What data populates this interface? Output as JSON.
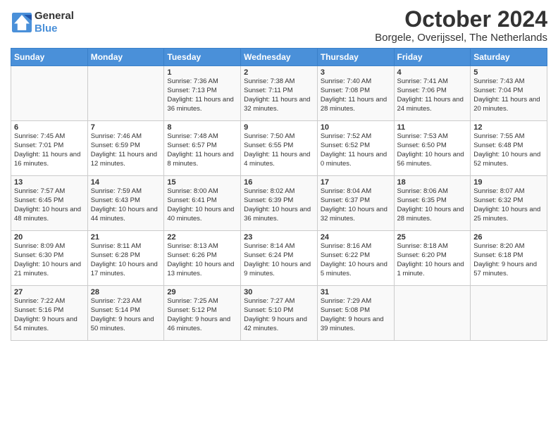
{
  "header": {
    "logo_line1": "General",
    "logo_line2": "Blue",
    "title": "October 2024",
    "subtitle": "Borgele, Overijssel, The Netherlands"
  },
  "days_of_week": [
    "Sunday",
    "Monday",
    "Tuesday",
    "Wednesday",
    "Thursday",
    "Friday",
    "Saturday"
  ],
  "weeks": [
    [
      {
        "day": "",
        "info": ""
      },
      {
        "day": "",
        "info": ""
      },
      {
        "day": "1",
        "info": "Sunrise: 7:36 AM\nSunset: 7:13 PM\nDaylight: 11 hours and 36 minutes."
      },
      {
        "day": "2",
        "info": "Sunrise: 7:38 AM\nSunset: 7:11 PM\nDaylight: 11 hours and 32 minutes."
      },
      {
        "day": "3",
        "info": "Sunrise: 7:40 AM\nSunset: 7:08 PM\nDaylight: 11 hours and 28 minutes."
      },
      {
        "day": "4",
        "info": "Sunrise: 7:41 AM\nSunset: 7:06 PM\nDaylight: 11 hours and 24 minutes."
      },
      {
        "day": "5",
        "info": "Sunrise: 7:43 AM\nSunset: 7:04 PM\nDaylight: 11 hours and 20 minutes."
      }
    ],
    [
      {
        "day": "6",
        "info": "Sunrise: 7:45 AM\nSunset: 7:01 PM\nDaylight: 11 hours and 16 minutes."
      },
      {
        "day": "7",
        "info": "Sunrise: 7:46 AM\nSunset: 6:59 PM\nDaylight: 11 hours and 12 minutes."
      },
      {
        "day": "8",
        "info": "Sunrise: 7:48 AM\nSunset: 6:57 PM\nDaylight: 11 hours and 8 minutes."
      },
      {
        "day": "9",
        "info": "Sunrise: 7:50 AM\nSunset: 6:55 PM\nDaylight: 11 hours and 4 minutes."
      },
      {
        "day": "10",
        "info": "Sunrise: 7:52 AM\nSunset: 6:52 PM\nDaylight: 11 hours and 0 minutes."
      },
      {
        "day": "11",
        "info": "Sunrise: 7:53 AM\nSunset: 6:50 PM\nDaylight: 10 hours and 56 minutes."
      },
      {
        "day": "12",
        "info": "Sunrise: 7:55 AM\nSunset: 6:48 PM\nDaylight: 10 hours and 52 minutes."
      }
    ],
    [
      {
        "day": "13",
        "info": "Sunrise: 7:57 AM\nSunset: 6:45 PM\nDaylight: 10 hours and 48 minutes."
      },
      {
        "day": "14",
        "info": "Sunrise: 7:59 AM\nSunset: 6:43 PM\nDaylight: 10 hours and 44 minutes."
      },
      {
        "day": "15",
        "info": "Sunrise: 8:00 AM\nSunset: 6:41 PM\nDaylight: 10 hours and 40 minutes."
      },
      {
        "day": "16",
        "info": "Sunrise: 8:02 AM\nSunset: 6:39 PM\nDaylight: 10 hours and 36 minutes."
      },
      {
        "day": "17",
        "info": "Sunrise: 8:04 AM\nSunset: 6:37 PM\nDaylight: 10 hours and 32 minutes."
      },
      {
        "day": "18",
        "info": "Sunrise: 8:06 AM\nSunset: 6:35 PM\nDaylight: 10 hours and 28 minutes."
      },
      {
        "day": "19",
        "info": "Sunrise: 8:07 AM\nSunset: 6:32 PM\nDaylight: 10 hours and 25 minutes."
      }
    ],
    [
      {
        "day": "20",
        "info": "Sunrise: 8:09 AM\nSunset: 6:30 PM\nDaylight: 10 hours and 21 minutes."
      },
      {
        "day": "21",
        "info": "Sunrise: 8:11 AM\nSunset: 6:28 PM\nDaylight: 10 hours and 17 minutes."
      },
      {
        "day": "22",
        "info": "Sunrise: 8:13 AM\nSunset: 6:26 PM\nDaylight: 10 hours and 13 minutes."
      },
      {
        "day": "23",
        "info": "Sunrise: 8:14 AM\nSunset: 6:24 PM\nDaylight: 10 hours and 9 minutes."
      },
      {
        "day": "24",
        "info": "Sunrise: 8:16 AM\nSunset: 6:22 PM\nDaylight: 10 hours and 5 minutes."
      },
      {
        "day": "25",
        "info": "Sunrise: 8:18 AM\nSunset: 6:20 PM\nDaylight: 10 hours and 1 minute."
      },
      {
        "day": "26",
        "info": "Sunrise: 8:20 AM\nSunset: 6:18 PM\nDaylight: 9 hours and 57 minutes."
      }
    ],
    [
      {
        "day": "27",
        "info": "Sunrise: 7:22 AM\nSunset: 5:16 PM\nDaylight: 9 hours and 54 minutes."
      },
      {
        "day": "28",
        "info": "Sunrise: 7:23 AM\nSunset: 5:14 PM\nDaylight: 9 hours and 50 minutes."
      },
      {
        "day": "29",
        "info": "Sunrise: 7:25 AM\nSunset: 5:12 PM\nDaylight: 9 hours and 46 minutes."
      },
      {
        "day": "30",
        "info": "Sunrise: 7:27 AM\nSunset: 5:10 PM\nDaylight: 9 hours and 42 minutes."
      },
      {
        "day": "31",
        "info": "Sunrise: 7:29 AM\nSunset: 5:08 PM\nDaylight: 9 hours and 39 minutes."
      },
      {
        "day": "",
        "info": ""
      },
      {
        "day": "",
        "info": ""
      }
    ]
  ]
}
